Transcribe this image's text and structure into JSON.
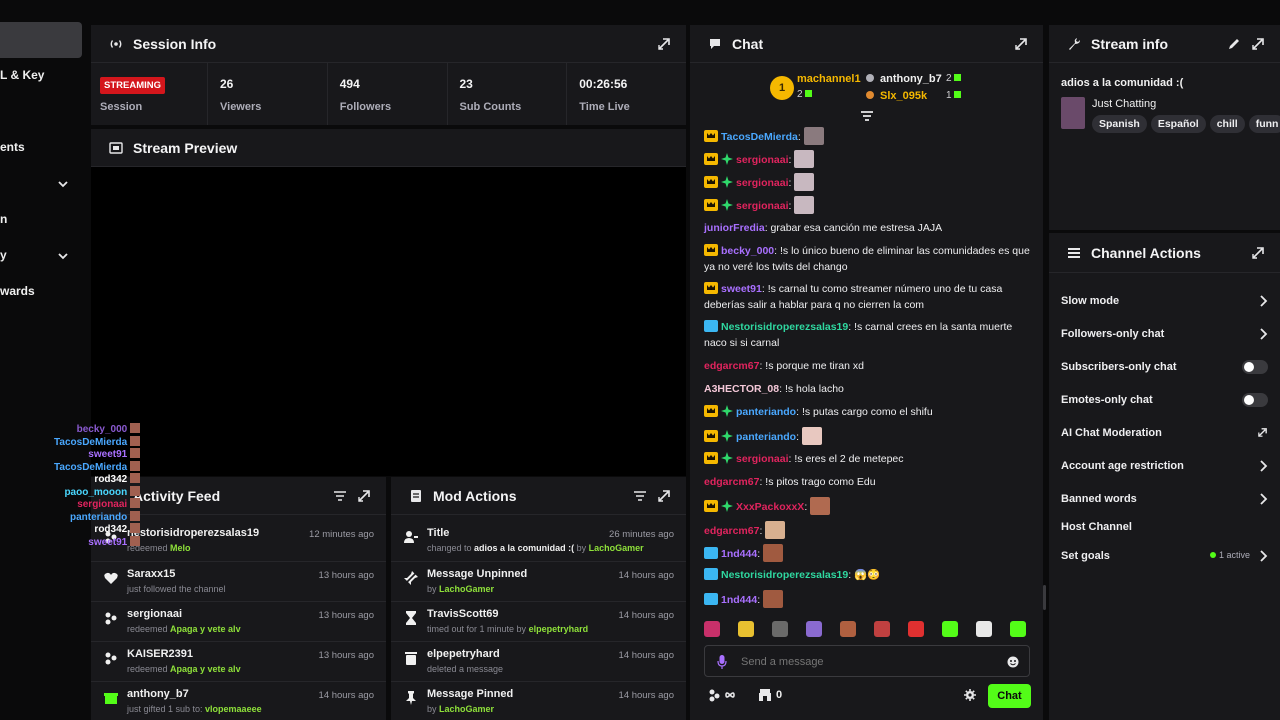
{
  "sidebar": {
    "items": [
      {
        "label": "L & Key"
      },
      {
        "label": "ents"
      },
      {
        "label": "n"
      },
      {
        "label": "y"
      },
      {
        "label": "wards"
      }
    ]
  },
  "session": {
    "title": "Session Info",
    "status_badge": "STREAMING",
    "stats": [
      {
        "value": "",
        "label": "Session"
      },
      {
        "value": "26",
        "label": "Viewers"
      },
      {
        "value": "494",
        "label": "Followers"
      },
      {
        "value": "23",
        "label": "Sub Counts"
      },
      {
        "value": "00:26:56",
        "label": "Time Live"
      }
    ]
  },
  "preview": {
    "title": "Stream Preview"
  },
  "activity": {
    "title": "Activity Feed",
    "items": [
      {
        "icon": "gift-icon",
        "user": "nestorisidroperezsalas19",
        "action": "redeemed ",
        "highlight": "Melo",
        "time": "12 minutes ago"
      },
      {
        "icon": "heart-icon",
        "user": "Saraxx15",
        "action": "just followed the channel",
        "highlight": "",
        "time": "13 hours ago"
      },
      {
        "icon": "points-icon",
        "user": "sergionaai",
        "action": "redeemed ",
        "highlight": "Apaga y vete alv",
        "time": "13 hours ago"
      },
      {
        "icon": "points-icon",
        "user": "KAISER2391",
        "action": "redeemed ",
        "highlight": "Apaga y vete alv",
        "time": "13 hours ago"
      },
      {
        "icon": "gift-sub-icon",
        "user": "anthony_b7",
        "action": "just gifted 1 sub to: ",
        "highlight": "vlopemaaeee",
        "time": "14 hours ago"
      }
    ]
  },
  "mod": {
    "title": "Mod Actions",
    "items": [
      {
        "icon": "user-edit-icon",
        "title": "Title",
        "pre": "changed to ",
        "bold": "adios a la comunidad :(",
        "mid": " by ",
        "user": "LachoGamer",
        "time": "26 minutes ago"
      },
      {
        "icon": "unpin-icon",
        "title": "Message Unpinned",
        "pre": "by ",
        "bold": "",
        "mid": "",
        "user": "LachoGamer",
        "time": "14 hours ago"
      },
      {
        "icon": "hourglass-icon",
        "title": "TravisScott69",
        "pre": "timed out for 1 minute by ",
        "bold": "",
        "mid": "",
        "user": "elpepetryhard",
        "time": "14 hours ago"
      },
      {
        "icon": "trash-icon",
        "title": "elpepetryhard",
        "pre": "deleted a message",
        "bold": "",
        "mid": "",
        "user": "",
        "time": "14 hours ago"
      },
      {
        "icon": "pin-icon",
        "title": "Message Pinned",
        "pre": "by ",
        "bold": "",
        "mid": "",
        "user": "LachoGamer",
        "time": "14 hours ago"
      }
    ]
  },
  "chat": {
    "title": "Chat",
    "leaders": {
      "first": {
        "rank": "1",
        "name": "machannel1",
        "count": "2"
      },
      "others": [
        {
          "name": "anthony_b7",
          "count": "2"
        },
        {
          "name": "Slx_095k",
          "count": "1"
        }
      ]
    },
    "messages": [
      {
        "badges": [
          "crown"
        ],
        "user": "TacosDeMierda",
        "color": "#4aa8ff",
        "text": "",
        "emote": "#8a7a7e"
      },
      {
        "badges": [
          "crown",
          "spark"
        ],
        "user": "sergionaai",
        "color": "#e0245e",
        "text": "",
        "emote": "#c8b8c0"
      },
      {
        "badges": [
          "crown",
          "spark"
        ],
        "user": "sergionaai",
        "color": "#e0245e",
        "text": "",
        "emote": "#c8b8c0"
      },
      {
        "badges": [
          "crown",
          "spark"
        ],
        "user": "sergionaai",
        "color": "#e0245e",
        "text": "",
        "emote": "#c8b8c0"
      },
      {
        "badges": [],
        "user": "juniorFredia",
        "color": "#a970ff",
        "text": "grabar esa canción me estresa JAJA",
        "emote": ""
      },
      {
        "badges": [
          "crown"
        ],
        "user": "becky_000",
        "color": "#a970ff",
        "text": "!s lo único bueno de eliminar las comunidades es que ya no veré los twits del chango",
        "emote": ""
      },
      {
        "badges": [
          "crown"
        ],
        "user": "sweet91",
        "color": "#a970ff",
        "text": "!s carnal tu como streamer número uno de tu casa deberías salir a hablar para q no cierren la com",
        "emote": ""
      },
      {
        "badges": [
          "prime"
        ],
        "user": "Nestorisidroperezsalas19",
        "color": "#2fd8a0",
        "text": "!s carnal crees en la santa muerte naco si si carnal",
        "emote": ""
      },
      {
        "badges": [],
        "user": "edgarcm67",
        "color": "#e0245e",
        "text": "!s porque me tiran xd",
        "emote": ""
      },
      {
        "badges": [],
        "user": "A3HECTOR_08",
        "color": "#f4c8d8",
        "text": "!s hola lacho",
        "emote": ""
      },
      {
        "badges": [
          "crown",
          "spark"
        ],
        "user": "panteriando",
        "color": "#4aa8ff",
        "text": "!s putas cargo como el shifu",
        "emote": ""
      },
      {
        "badges": [
          "crown",
          "spark"
        ],
        "user": "panteriando",
        "color": "#4aa8ff",
        "text": "",
        "emote": "#e8c8c0"
      },
      {
        "badges": [
          "crown",
          "spark"
        ],
        "user": "sergionaai",
        "color": "#e0245e",
        "text": "!s eres el 2 de metepec",
        "emote": ""
      },
      {
        "badges": [],
        "user": "edgarcm67",
        "color": "#e0245e",
        "text": "!s pitos trago como Edu",
        "emote": ""
      },
      {
        "badges": [
          "crown",
          "spark"
        ],
        "user": "XxxPackoxxX",
        "color": "#e0245e",
        "text": "",
        "emote": "#b06a50"
      },
      {
        "badges": [],
        "user": "edgarcm67",
        "color": "#e0245e",
        "text": "",
        "emote": "#d8b090"
      },
      {
        "badges": [
          "prime"
        ],
        "user": "1nd444",
        "color": "#a970ff",
        "text": "",
        "emote": "#a05a40"
      },
      {
        "badges": [
          "prime"
        ],
        "user": "Nestorisidroperezsalas19",
        "color": "#2fd8a0",
        "text": "😱😳",
        "emote": ""
      },
      {
        "badges": [
          "prime"
        ],
        "user": "1nd444",
        "color": "#a970ff",
        "text": "",
        "emote": "#a05a40"
      }
    ],
    "input_placeholder": "Send a message",
    "points": "0",
    "send_label": "Chat"
  },
  "stream_info": {
    "title": "Stream info",
    "stream_title": "adios a la comunidad :(",
    "category": "Just Chatting",
    "tags": [
      "Spanish",
      "Español",
      "chill",
      "funn"
    ]
  },
  "channel_actions": {
    "title": "Channel Actions",
    "items": [
      {
        "label": "Slow mode",
        "control": "arrow",
        "extra": ""
      },
      {
        "label": "Followers-only chat",
        "control": "arrow",
        "extra": ""
      },
      {
        "label": "Subscribers-only chat",
        "control": "toggle",
        "extra": ""
      },
      {
        "label": "Emotes-only chat",
        "control": "toggle",
        "extra": ""
      },
      {
        "label": "AI Chat Moderation",
        "control": "external",
        "extra": ""
      },
      {
        "label": "Account age restriction",
        "control": "arrow",
        "extra": ""
      },
      {
        "label": "Banned words",
        "control": "arrow",
        "extra": ""
      },
      {
        "label": "Host Channel",
        "control": "none",
        "extra": ""
      },
      {
        "label": "Set goals",
        "control": "arrow",
        "extra": "1 active"
      }
    ]
  },
  "overlay_chat": [
    {
      "name": "becky_000",
      "color": "#8a5ad0"
    },
    {
      "name": "TacosDeMierda",
      "color": "#4aa8ff"
    },
    {
      "name": "sweet91",
      "color": "#a970ff"
    },
    {
      "name": "TacosDeMierda",
      "color": "#4aa8ff"
    },
    {
      "name": "rod342",
      "color": "#ffffff"
    },
    {
      "name": "paoo_mooon",
      "color": "#4ad8ff"
    },
    {
      "name": "sergionaai",
      "color": "#e0245e"
    },
    {
      "name": "panteriando",
      "color": "#4aa8ff"
    },
    {
      "name": "rod342",
      "color": "#ffffff"
    },
    {
      "name": "sweet91",
      "color": "#a970ff"
    }
  ],
  "colors": {
    "accent_green": "#53fc18",
    "streaming_red": "#d4161c"
  }
}
